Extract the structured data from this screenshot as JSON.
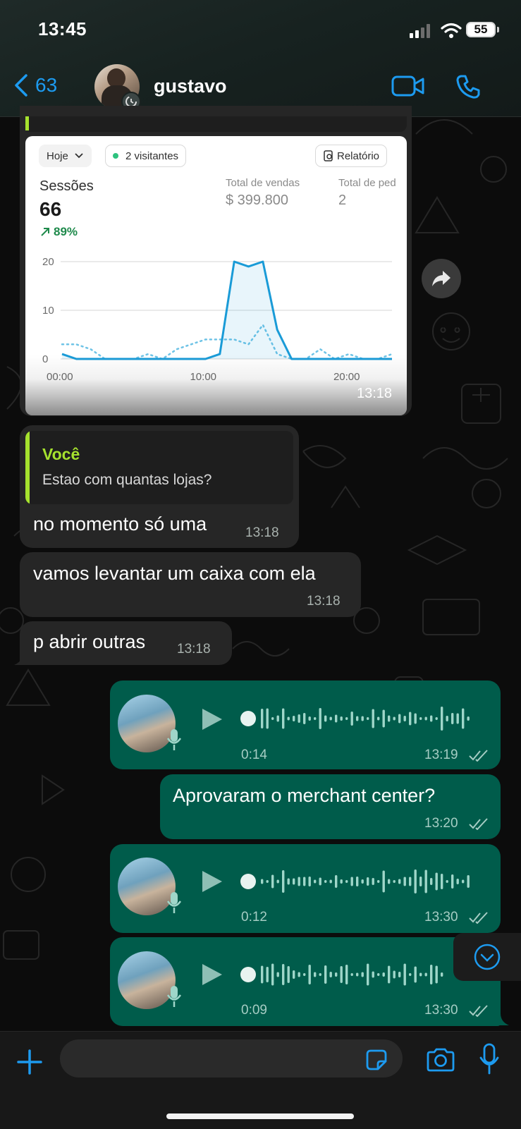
{
  "status_bar": {
    "time": "13:45",
    "battery": "55"
  },
  "header": {
    "back_count": "63",
    "contact_name": "gustavo"
  },
  "image_card": {
    "filter_label": "Hoje",
    "visitors_label": "2 visitantes",
    "report_label": "Relatório",
    "sessions_label": "Sessões",
    "sessions_value": "66",
    "sessions_change": "89%",
    "sales_label": "Total de vendas",
    "sales_value": "$ 399.800",
    "orders_label": "Total de ped",
    "orders_value": "2",
    "timestamp": "13:18"
  },
  "chart_data": {
    "type": "line",
    "y_ticks": [
      "20",
      "10",
      "0"
    ],
    "x_ticks": [
      "00:00",
      "10:00",
      "20:00"
    ],
    "ylim": [
      0,
      20
    ],
    "series": [
      {
        "values": [
          1,
          0,
          0,
          0,
          0,
          0,
          0,
          0,
          0,
          0,
          0,
          1,
          20,
          19,
          20,
          6,
          0,
          0,
          0,
          0,
          0,
          0,
          0,
          0
        ]
      },
      {
        "values": [
          3,
          3,
          2,
          0,
          0,
          0,
          1,
          0,
          2,
          3,
          4,
          4,
          4,
          3,
          7,
          1,
          0,
          0,
          2,
          0,
          1,
          0,
          0,
          1
        ]
      }
    ]
  },
  "messages": {
    "reply": {
      "quoted_author": "Você",
      "quoted_text": "Estao com quantas lojas?",
      "text": "no momento só uma",
      "time": "13:18"
    },
    "m2": {
      "text": "vamos levantar um caixa com ela",
      "time": "13:18"
    },
    "m3": {
      "text": "p abrir outras",
      "time": "13:18"
    },
    "voice1": {
      "duration": "0:14",
      "time": "13:19"
    },
    "m4": {
      "text": "Aprovaram o merchant center?",
      "time": "13:20"
    },
    "voice2": {
      "duration": "0:12",
      "time": "13:30"
    },
    "voice3": {
      "duration": "0:09",
      "time": "13:30"
    }
  },
  "colors": {
    "accent": "#1d9bf0",
    "outgoing": "#005c4b",
    "incoming": "#262626",
    "quote_bar": "#a6e22e",
    "chart_line": "#1a9bd7"
  }
}
